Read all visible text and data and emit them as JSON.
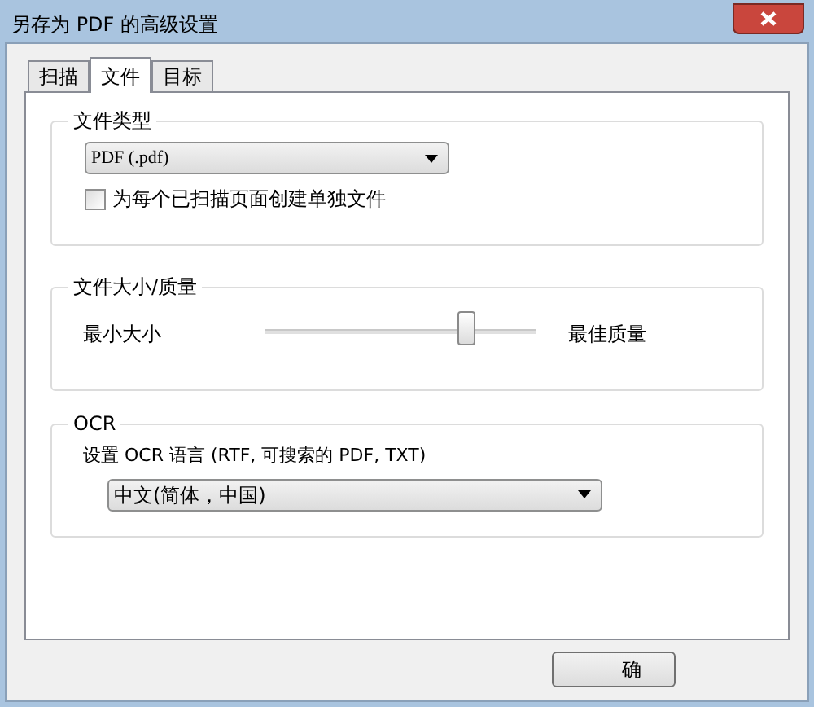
{
  "window": {
    "title": "另存为 PDF 的高级设置"
  },
  "tabs": [
    {
      "label": "扫描",
      "selected": false
    },
    {
      "label": "文件",
      "selected": true
    },
    {
      "label": "目标",
      "selected": false
    }
  ],
  "file_type": {
    "title": "文件类型",
    "dropdown": {
      "value": "PDF (.pdf)"
    },
    "checkbox": {
      "label": "为每个已扫描页面创建单独文件",
      "checked": false
    }
  },
  "size_quality": {
    "title": "文件大小/质量",
    "min_label": "最小大小",
    "max_label": "最佳质量",
    "slider": {
      "level": 0.74
    }
  },
  "ocr": {
    "title": "OCR",
    "label": "设置 OCR 语言 (RTF, 可搜索的 PDF, TXT)",
    "dropdown": {
      "value": "中文(简体，中国)"
    }
  },
  "buttons": [
    "确"
  ]
}
